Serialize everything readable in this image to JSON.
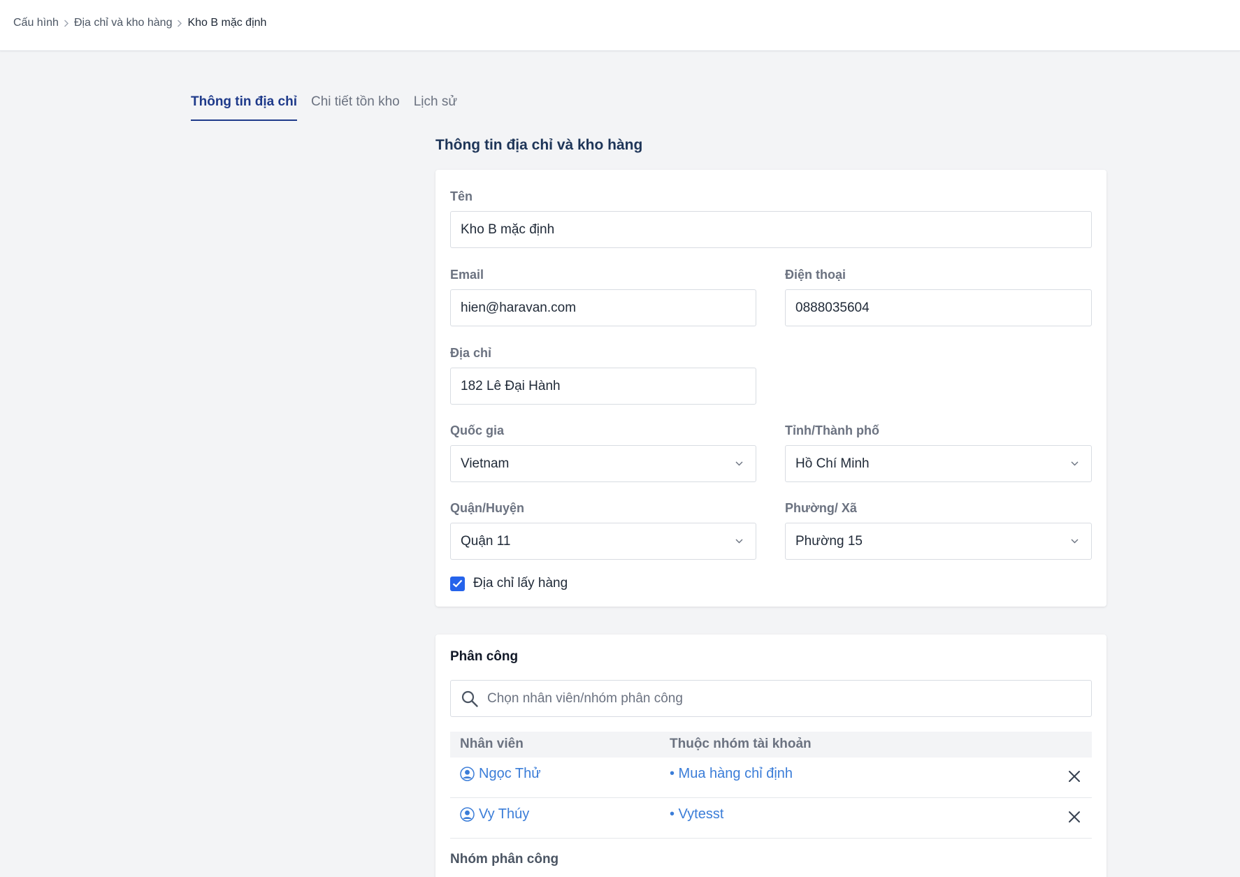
{
  "breadcrumb": [
    "Cấu hình",
    "Địa chỉ và kho hàng",
    "Kho B mặc định"
  ],
  "tabs": [
    "Thông tin địa chỉ",
    "Chi tiết tồn kho",
    "Lịch sử"
  ],
  "section_title": "Thông tin địa chỉ và kho hàng",
  "form": {
    "name": {
      "label": "Tên",
      "value": "Kho B mặc định"
    },
    "email": {
      "label": "Email",
      "value": "hien@haravan.com"
    },
    "phone": {
      "label": "Điện thoại",
      "value": "0888035604"
    },
    "address": {
      "label": "Địa chỉ",
      "value": "182 Lê Đại Hành"
    },
    "country": {
      "label": "Quốc gia",
      "value": "Vietnam"
    },
    "province": {
      "label": "Tỉnh/Thành phố",
      "value": "Hồ Chí Minh"
    },
    "district": {
      "label": "Quận/Huyện",
      "value": "Quận 11"
    },
    "ward": {
      "label": "Phường/ Xã",
      "value": "Phường 15"
    },
    "pickup": {
      "label": "Địa chỉ lấy hàng",
      "checked": true
    }
  },
  "assignment": {
    "title": "Phân công",
    "search_placeholder": "Chọn nhân viên/nhóm phân công",
    "columns": [
      "Nhân viên",
      "Thuộc nhóm tài khoản"
    ],
    "rows": [
      {
        "user": "Ngọc Thử",
        "group": "• Mua hàng chỉ định"
      },
      {
        "user": "Vy Thúy",
        "group": "• Vytesst"
      }
    ],
    "group_section_title": "Nhóm phân công"
  },
  "colors": {
    "accent": "#2563eb",
    "link": "#3b7dd8",
    "tab_active": "#1e3a8a"
  },
  "icons": [
    "chevron-right-icon",
    "chevron-down-icon",
    "check-icon",
    "search-icon",
    "user-icon",
    "close-icon"
  ]
}
